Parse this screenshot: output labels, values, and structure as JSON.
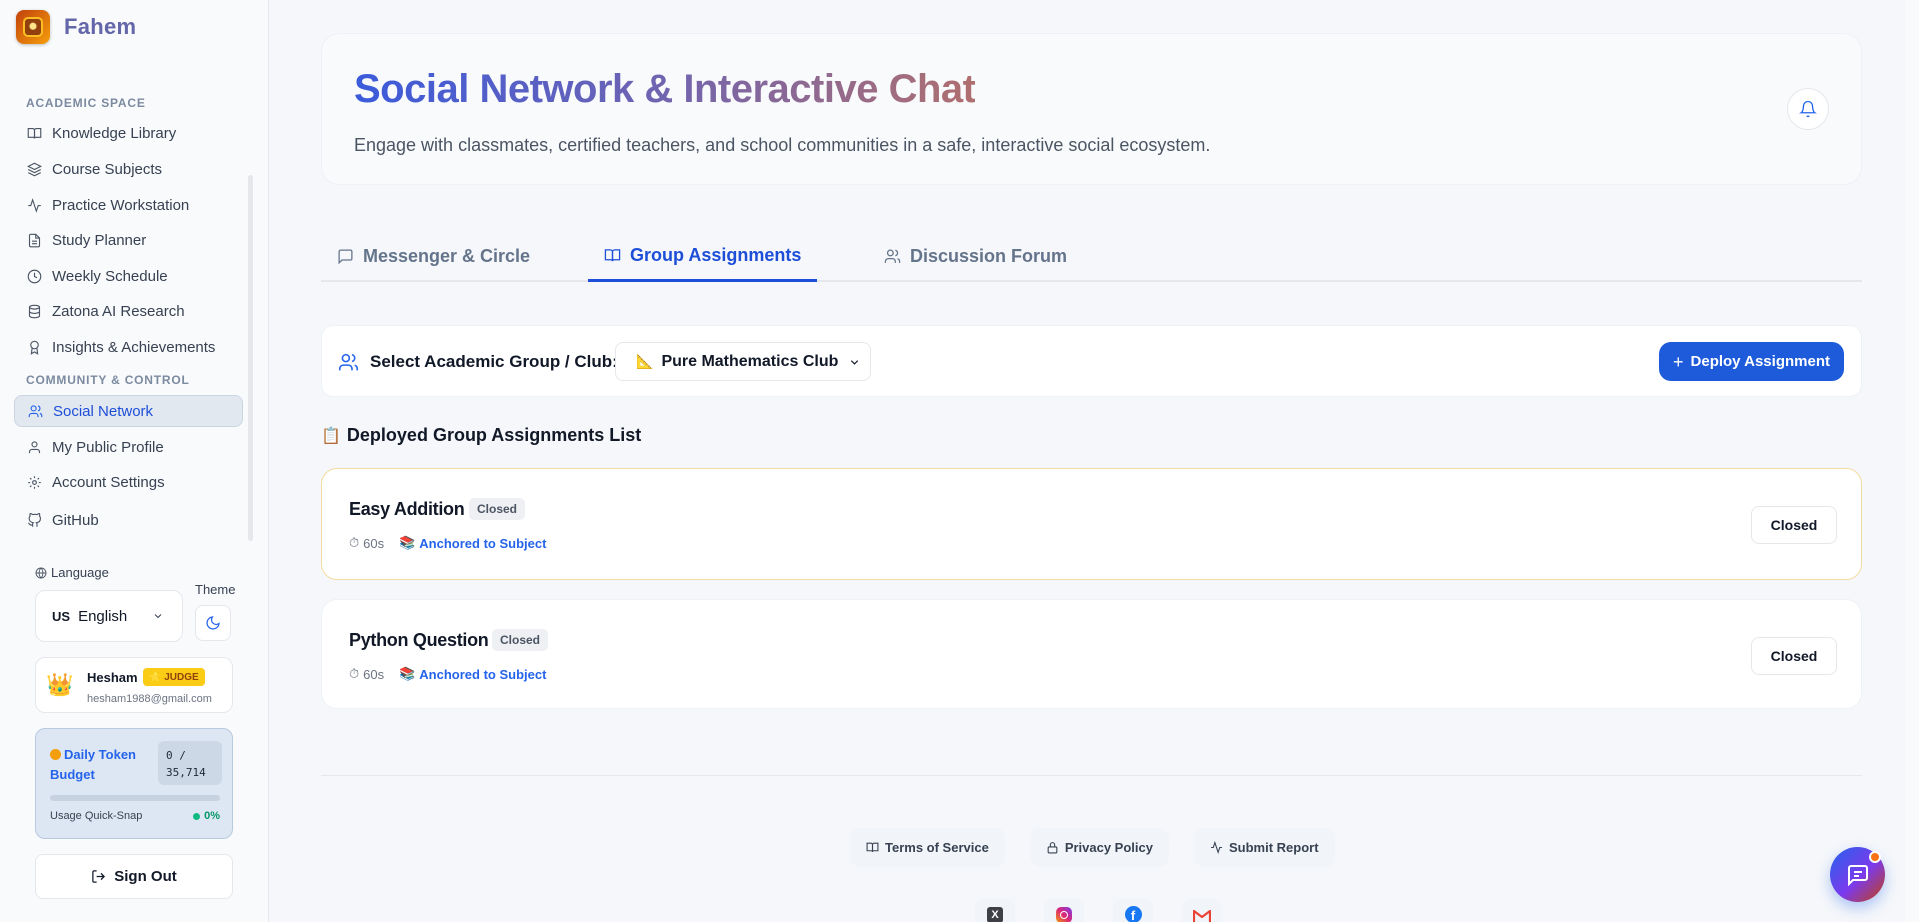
{
  "brand": {
    "name": "Fahem"
  },
  "sidebar": {
    "sections": [
      {
        "label": "ACADEMIC SPACE"
      },
      {
        "label": "COMMUNITY & CONTROL"
      }
    ],
    "items": [
      {
        "label": "Knowledge Library",
        "icon": "book-icon"
      },
      {
        "label": "Course Subjects",
        "icon": "layers-icon"
      },
      {
        "label": "Practice Workstation",
        "icon": "activity-icon"
      },
      {
        "label": "Study Planner",
        "icon": "file-icon"
      },
      {
        "label": "Weekly Schedule",
        "icon": "clock-icon"
      },
      {
        "label": "Zatona AI Research",
        "icon": "database-icon"
      },
      {
        "label": "Insights & Achievements",
        "icon": "award-icon"
      },
      {
        "label": "Social Network",
        "icon": "users-icon",
        "active": true
      },
      {
        "label": "My Public Profile",
        "icon": "user-icon"
      },
      {
        "label": "Account Settings",
        "icon": "gear-icon"
      },
      {
        "label": "GitHub",
        "icon": "github-icon"
      }
    ],
    "language_label": "Language",
    "theme_label": "Theme",
    "language": {
      "flag": "US",
      "value": "English"
    },
    "user": {
      "name": "Hesham",
      "badge": "⭐ JUDGE",
      "email": "hesham1988@gmail.com",
      "avatar": "👑"
    },
    "token": {
      "title": "Daily Token Budget",
      "used": "0 /",
      "total": "35,714",
      "usage_label": "Usage Quick-Snap",
      "percent": "0%"
    },
    "sign_out": "Sign Out"
  },
  "header": {
    "title": "Social Network & Interactive Chat",
    "subtitle": "Engage with classmates, certified teachers, and school communities in a safe, interactive social ecosystem."
  },
  "tabs": [
    {
      "label": "Messenger & Circle",
      "icon": "message-icon"
    },
    {
      "label": "Group Assignments",
      "icon": "book-open-icon",
      "active": true
    },
    {
      "label": "Discussion Forum",
      "icon": "users-icon"
    }
  ],
  "group_select": {
    "label": "Select Academic Group / Club:",
    "emoji": "📐",
    "value": "Pure Mathematics Club",
    "deploy_button": "Deploy Assignment"
  },
  "list": {
    "heading_emoji": "📋",
    "heading": "Deployed Group Assignments List",
    "assignments": [
      {
        "title": "Easy Addition",
        "status": "Closed",
        "time": "60s",
        "anchor": "Anchored to Subject",
        "action": "Closed"
      },
      {
        "title": "Python Question",
        "status": "Closed",
        "time": "60s",
        "anchor": "Anchored to Subject",
        "action": "Closed"
      }
    ]
  },
  "footer": {
    "links": [
      {
        "label": "Terms of Service",
        "icon": "book-icon"
      },
      {
        "label": "Privacy Policy",
        "icon": "lock-icon"
      },
      {
        "label": "Submit Report",
        "icon": "activity-icon"
      }
    ],
    "socials": [
      "x-icon",
      "instagram-icon",
      "facebook-icon",
      "gmail-icon"
    ]
  },
  "colors": {
    "accent": "#1d5bdb",
    "active_tab": "#1d4ed8",
    "badge": "#facc15"
  }
}
